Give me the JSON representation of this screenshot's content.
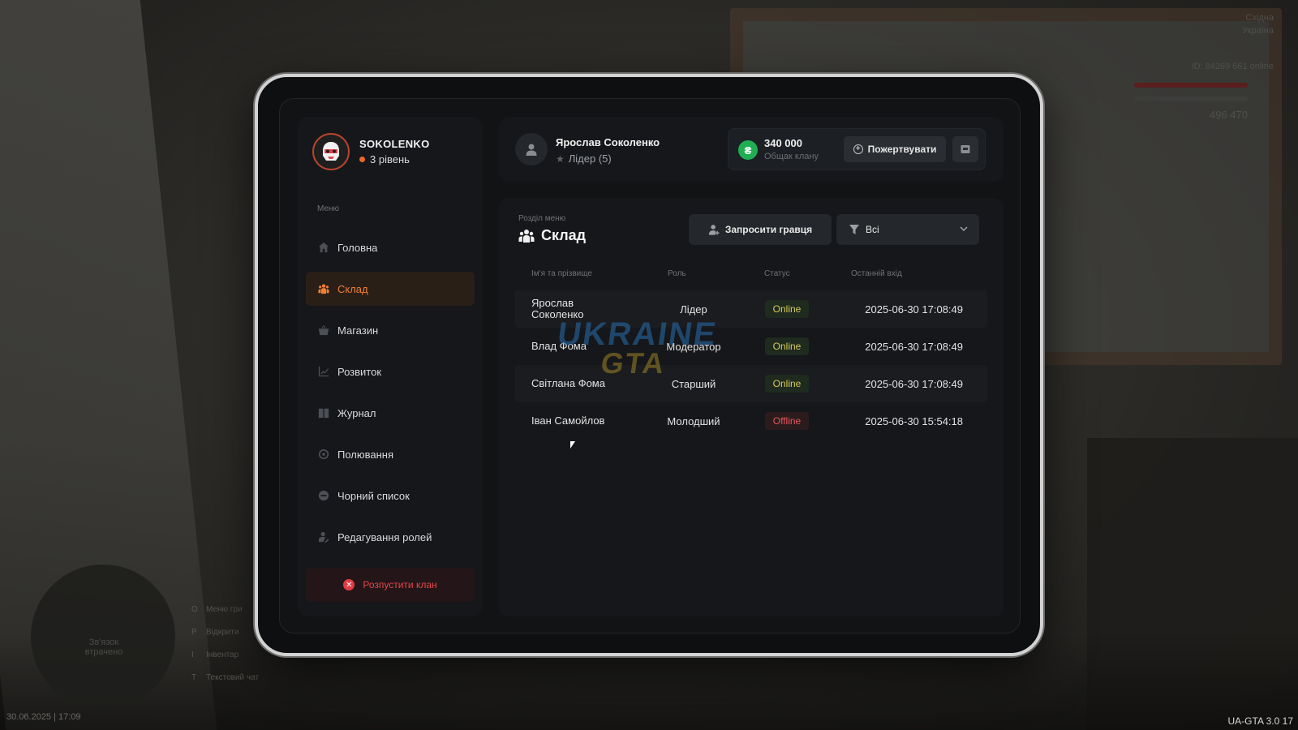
{
  "profile": {
    "name": "SOKOLENKO",
    "level": "3 рівень"
  },
  "menu": {
    "label": "Меню",
    "items": [
      {
        "label": "Головна",
        "icon": "home-icon"
      },
      {
        "label": "Склад",
        "icon": "members-icon",
        "active": true
      },
      {
        "label": "Магазин",
        "icon": "shop-icon"
      },
      {
        "label": "Розвиток",
        "icon": "chart-icon"
      },
      {
        "label": "Журнал",
        "icon": "book-icon"
      },
      {
        "label": "Полювання",
        "icon": "target-icon"
      },
      {
        "label": "Чорний список",
        "icon": "ban-icon"
      },
      {
        "label": "Редагування ролей",
        "icon": "user-edit-icon"
      }
    ],
    "disband_label": "Розпустити клан"
  },
  "header": {
    "leader_name": "Ярослав Соколенко",
    "leader_role": "Лідер (5)",
    "treasury_amount": "340 000",
    "treasury_label": "Общак клану",
    "donate_label": "Пожертвувати"
  },
  "main": {
    "section_label": "Розділ меню",
    "section_title": "Склад",
    "invite_label": "Запросити гравця",
    "filter_value": "Всі",
    "columns": [
      "Ім'я та прізвище",
      "Роль",
      "Статус",
      "Останній вхід"
    ],
    "rows": [
      {
        "name": "Ярослав Соколенко",
        "role": "Лідер",
        "status": "Online",
        "last": "2025-06-30 17:08:49"
      },
      {
        "name": "Влад Фома",
        "role": "Модератор",
        "status": "Online",
        "last": "2025-06-30 17:08:49"
      },
      {
        "name": "Світлана Фома",
        "role": "Старший",
        "status": "Online",
        "last": "2025-06-30 17:08:49"
      },
      {
        "name": "Іван Самойлов",
        "role": "Молодший",
        "status": "Offline",
        "last": "2025-06-30 15:54:18"
      }
    ],
    "watermark": [
      "UKRAINE",
      "GTA"
    ]
  },
  "hud": {
    "datetime": "30.06.2025 | 17:09",
    "version": "UA-GTA 3.0",
    "version_suffix": "17",
    "radar_text": "Зв'язок втрачено",
    "region": [
      "Східна",
      "Україна"
    ],
    "server_info": "ID: 84269   661 online",
    "money": "496 470",
    "keybinds": [
      {
        "key": "O",
        "label": "Меню гри"
      },
      {
        "key": "P",
        "label": "Відкрити"
      },
      {
        "key": "I",
        "label": "Інвентар"
      },
      {
        "key": "T",
        "label": "Текстовий чат"
      }
    ]
  },
  "colors": {
    "accent": "#f07f34",
    "online": "#d5c95a",
    "offline": "#e4585c",
    "coin": "#1fae52",
    "danger": "#e23b45"
  }
}
